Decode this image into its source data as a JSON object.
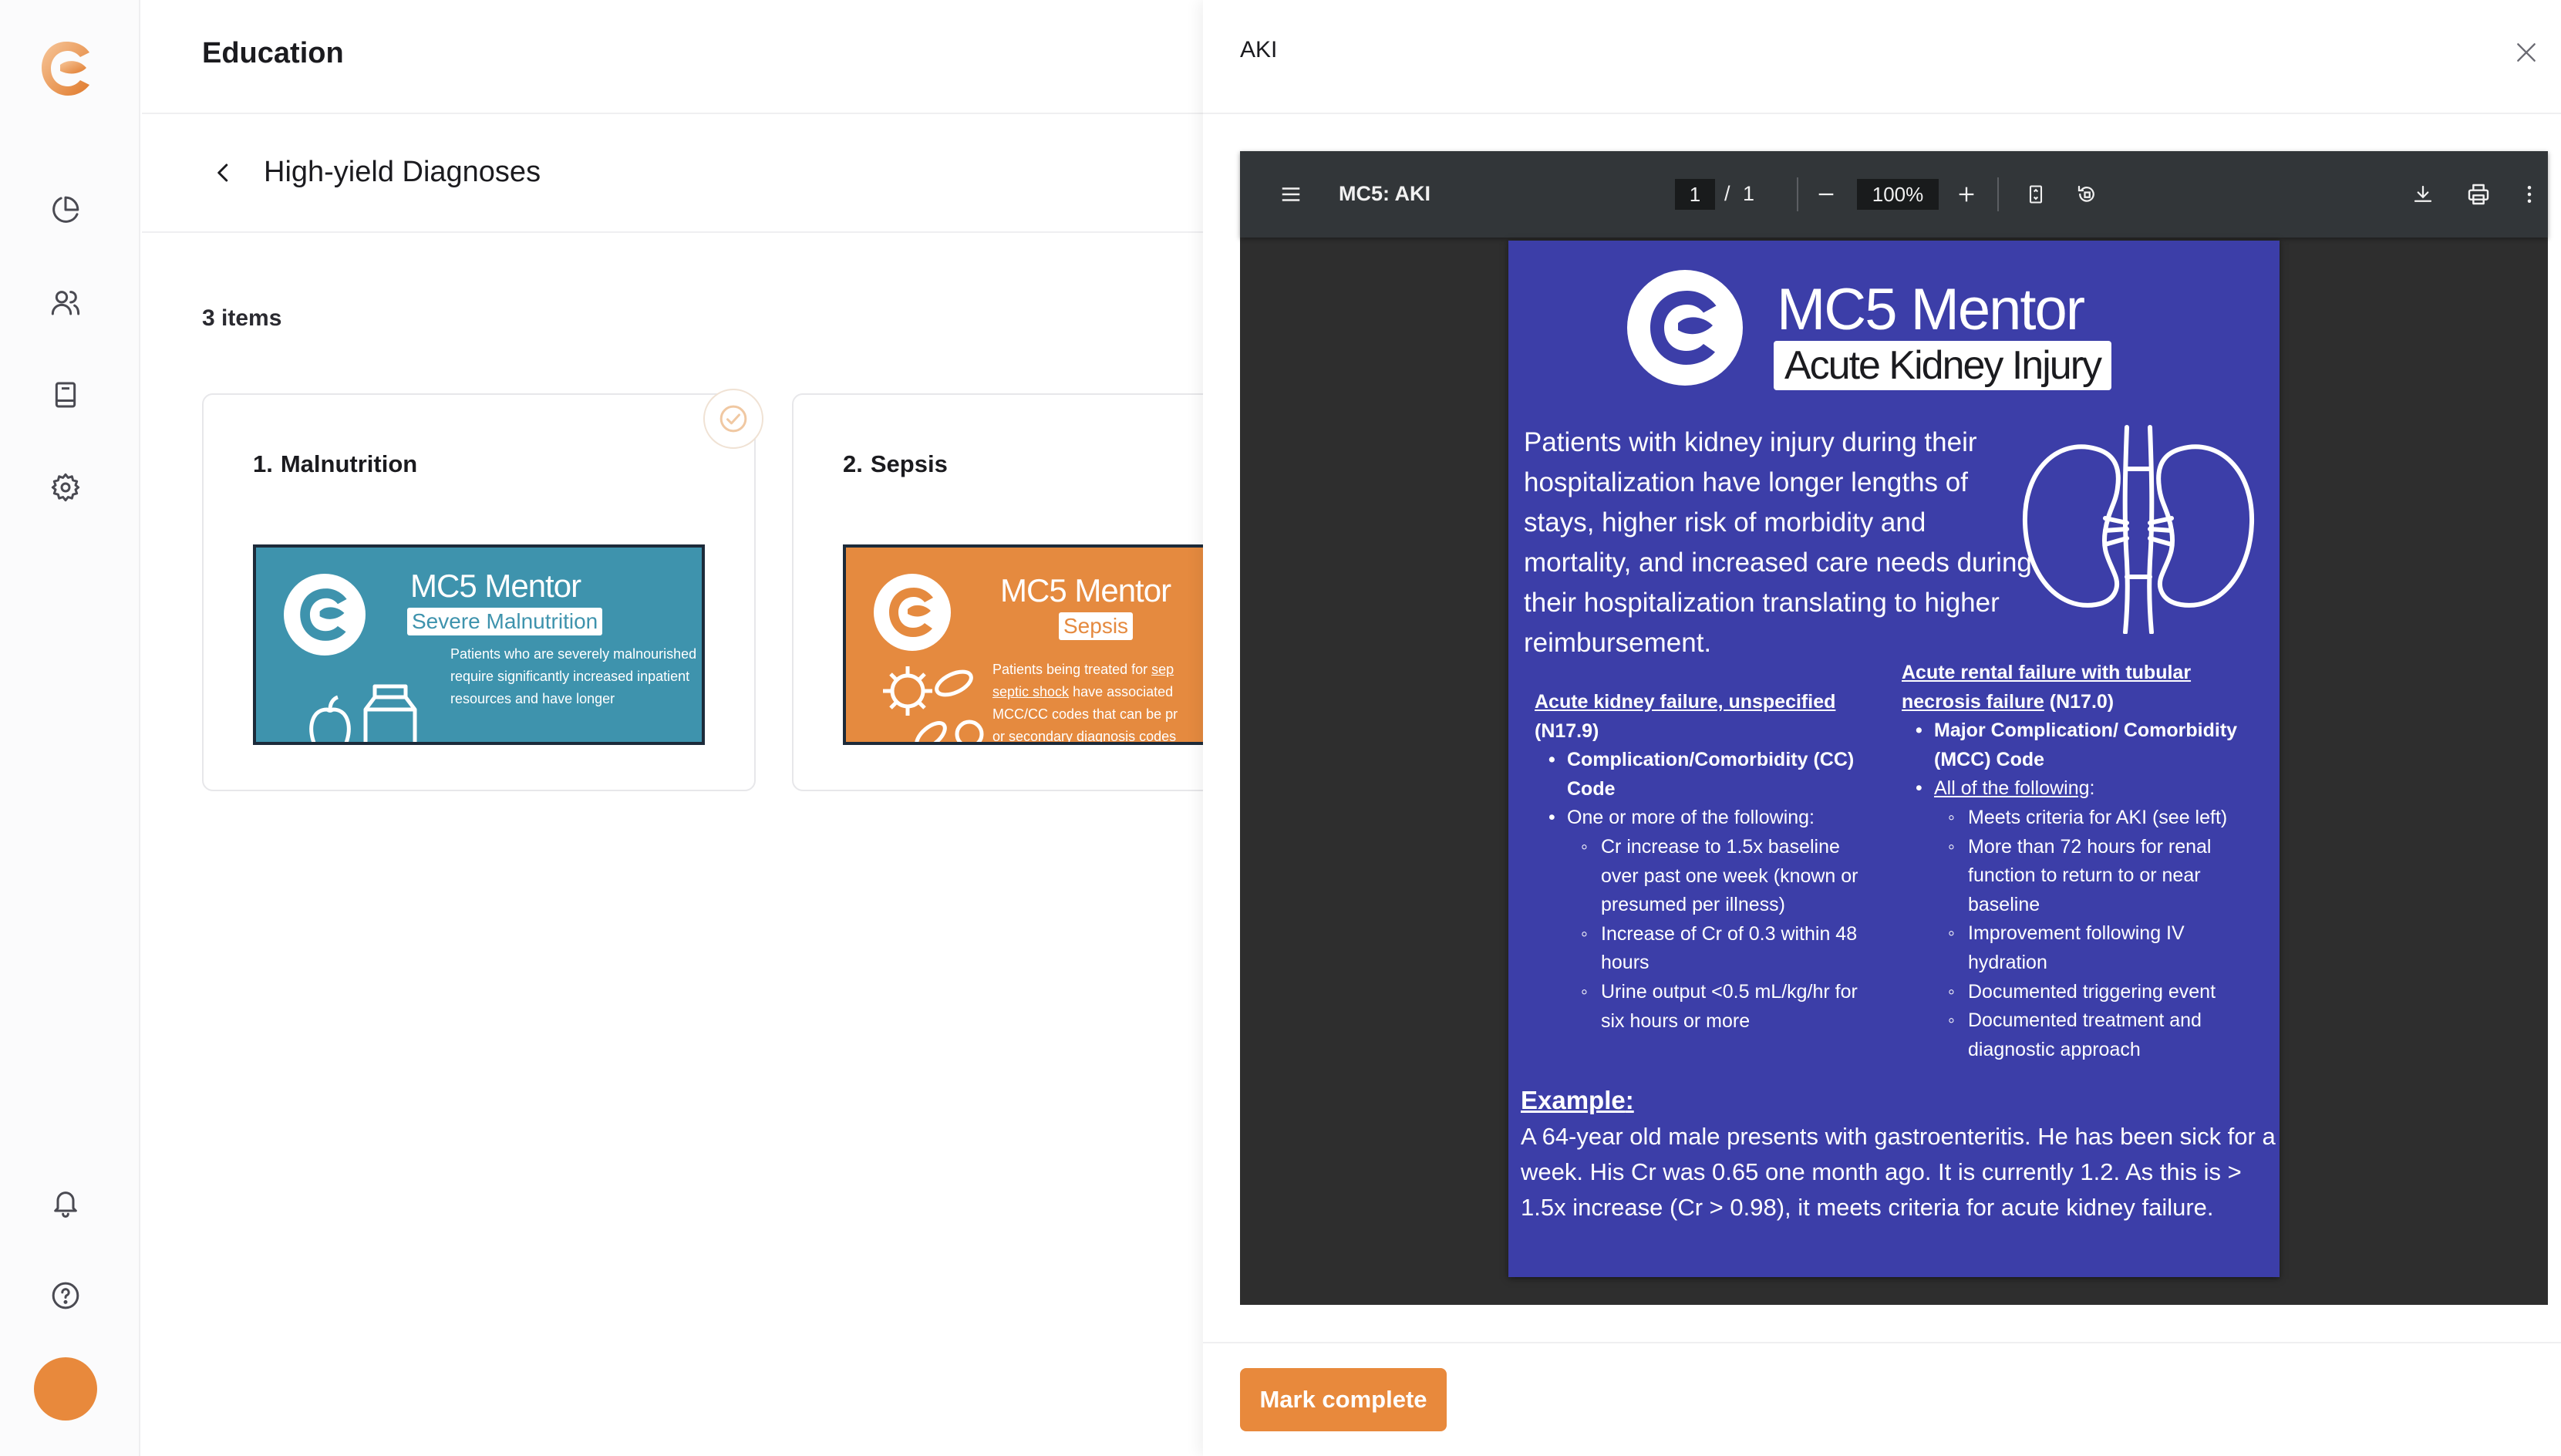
{
  "nav": {
    "items": [
      {
        "name": "dashboard",
        "icon": "pie-chart-icon"
      },
      {
        "name": "people",
        "icon": "users-icon"
      },
      {
        "name": "education",
        "icon": "book-icon"
      },
      {
        "name": "settings",
        "icon": "gear-icon"
      }
    ],
    "bottom": [
      {
        "name": "notifications",
        "icon": "bell-icon"
      },
      {
        "name": "help",
        "icon": "help-icon"
      }
    ],
    "accent": "#e8893c"
  },
  "main": {
    "title": "Education",
    "section_title": "High-yield Diagnoses",
    "count": "3 items",
    "cards": [
      {
        "number": "1.",
        "title": "Malnutrition",
        "thumb_title": "MC5 Mentor",
        "thumb_subtitle": "Severe Malnutrition",
        "thumb_text": "Patients who are severely malnourished require significantly increased inpatient resources and have longer",
        "thumb_color": "#3e93ad"
      },
      {
        "number": "2.",
        "title": "Sepsis",
        "thumb_title": "MC5 Mentor",
        "thumb_subtitle": "Sepsis",
        "thumb_text_1": "Patients being treated for",
        "thumb_link_1": "sep",
        "thumb_link_2": "septic shock",
        "thumb_text_2": "have associated",
        "thumb_text_3": "MCC/CC codes that can be pr",
        "thumb_text_4": "or secondary diagnosis codes",
        "thumb_color": "#e58a3f"
      }
    ]
  },
  "drawer": {
    "title": "AKI",
    "mark_complete_label": "Mark complete",
    "viewer": {
      "doc_name": "MC5: AKI",
      "page_current": "1",
      "page_sep": "/",
      "page_total": "1",
      "zoom": "100%"
    },
    "doc": {
      "brand": "MC5 Mentor",
      "subtitle": "Acute Kidney Injury",
      "intro": "Patients with kidney injury during their hospitalization have longer lengths of stays, higher risk of morbidity and mortality, and increased care needs during their hospitalization translating to higher reimbursement.",
      "left": {
        "heading": "Acute kidney failure, unspecified",
        "code": "(N17.9)",
        "b1": "Complication/Comorbidity (CC) Code",
        "b2": "One or more of the following:",
        "s1": "Cr increase to 1.5x baseline over past one week (known or presumed per illness)",
        "s2": "Increase of Cr of 0.3 within 48 hours",
        "s3": "Urine output <0.5 mL/kg/hr for six hours or more"
      },
      "right": {
        "heading": "Acute rental failure with tubular necrosis failure",
        "code": " (N17.0)",
        "b1": "Major Complication/ Comorbidity (MCC) Code",
        "b2_link": "All of the following",
        "b2_colon": ":",
        "s1": "Meets criteria for AKI (see left)",
        "s2": "More than 72 hours for renal function to return to or near baseline",
        "s3": "Improvement following IV hydration",
        "s4": "Documented triggering event",
        "s5": "Documented treatment and diagnostic approach"
      },
      "example_label": "Example",
      "example_colon": ":",
      "example_text": "A 64-year old male presents with gastroenteritis. He has been sick for a week. His Cr was 0.65 one month ago. It is currently 1.2. As this is > 1.5x increase (Cr > 0.98), it meets criteria for acute kidney failure.",
      "page_color": "#3c3ea8"
    }
  }
}
